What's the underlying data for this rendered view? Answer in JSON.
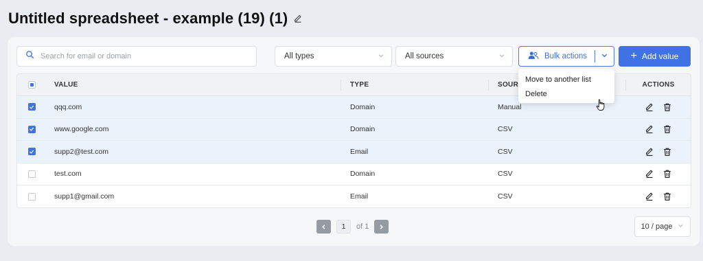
{
  "page": {
    "title": "Untitled spreadsheet - example (19) (1)"
  },
  "toolbar": {
    "search_placeholder": "Search for email or domain",
    "type_filter": "All types",
    "source_filter": "All sources",
    "bulk_label": "Bulk actions",
    "add_label": "Add value"
  },
  "bulk_menu": {
    "items": [
      "Move to another list",
      "Delete"
    ]
  },
  "table": {
    "headers": {
      "value": "VALUE",
      "type": "TYPE",
      "source": "SOURCE",
      "actions": "ACTIONS"
    },
    "rows": [
      {
        "value": "qqq.com",
        "type": "Domain",
        "source": "Manual",
        "checked": true
      },
      {
        "value": "www.google.com",
        "type": "Domain",
        "source": "CSV",
        "checked": true
      },
      {
        "value": "supp2@test.com",
        "type": "Email",
        "source": "CSV",
        "checked": true
      },
      {
        "value": "test.com",
        "type": "Domain",
        "source": "CSV",
        "checked": false
      },
      {
        "value": "supp1@gmail.com",
        "type": "Email",
        "source": "CSV",
        "checked": false
      }
    ]
  },
  "pagination": {
    "current": "1",
    "total": "of 1",
    "per_page": "10 / page"
  },
  "colors": {
    "accent": "#3f73e5",
    "selected_row": "#eaf3fc",
    "background": "#e9ecf1"
  }
}
